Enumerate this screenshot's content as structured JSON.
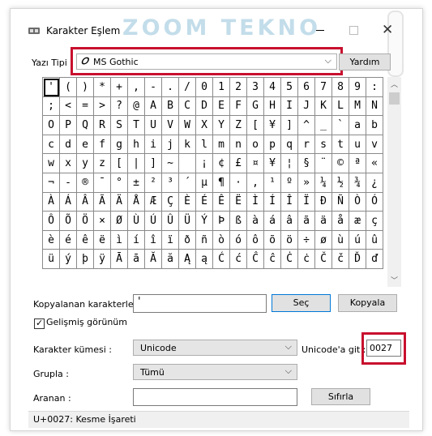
{
  "window": {
    "title": "Karakter Eşlem",
    "watermark": "ZOOM TEKNO"
  },
  "font_row": {
    "label": "Yazı Tipi :",
    "font_icon": "𝑂",
    "value": "MS Gothic",
    "help_button": "Yardım"
  },
  "characters": [
    "'",
    "(",
    ")",
    "*",
    "+",
    ",",
    "-",
    ".",
    "/",
    "0",
    "1",
    "2",
    "3",
    "4",
    "5",
    "6",
    "7",
    "8",
    "9",
    ":",
    ";",
    "<",
    "=",
    ">",
    "?",
    "@",
    "A",
    "B",
    "C",
    "D",
    "E",
    "F",
    "G",
    "H",
    "I",
    "J",
    "K",
    "L",
    "M",
    "N",
    "O",
    "P",
    "Q",
    "R",
    "S",
    "T",
    "U",
    "V",
    "W",
    "X",
    "Y",
    "Z",
    "[",
    "¥",
    "]",
    "^",
    "_",
    "`",
    "a",
    "b",
    "c",
    "d",
    "e",
    "f",
    "g",
    "h",
    "i",
    "j",
    "k",
    "l",
    "m",
    "n",
    "o",
    "p",
    "q",
    "r",
    "s",
    "t",
    "u",
    "v",
    "w",
    "x",
    "y",
    "z",
    "[",
    "|",
    "]",
    "~",
    " ",
    "¡",
    "¢",
    "£",
    "¤",
    "¥",
    "¦",
    "§",
    "¨",
    "©",
    "ª",
    "«",
    "¬",
    "-",
    "®",
    "¯",
    "°",
    "±",
    "²",
    "³",
    "´",
    "µ",
    "¶",
    "·",
    ",",
    "¹",
    "º",
    "»",
    "¼",
    "½",
    "¾",
    "¿",
    "À",
    "Á",
    "Â",
    "Ã",
    "Ä",
    "Å",
    "Æ",
    "Ç",
    "È",
    "É",
    "Ê",
    "Ë",
    "Ì",
    "Í",
    "Î",
    "Ï",
    "Ð",
    "Ñ",
    "Ò",
    "Ó",
    "Ô",
    "Õ",
    "Ö",
    "×",
    "Ø",
    "Ù",
    "Ú",
    "Û",
    "Ü",
    "Ý",
    "Þ",
    "ß",
    "à",
    "á",
    "â",
    "ã",
    "ä",
    "å",
    "æ",
    "ç",
    "è",
    "é",
    "ê",
    "ë",
    "ì",
    "í",
    "î",
    "ï",
    "ð",
    "ñ",
    "ò",
    "ó",
    "ô",
    "õ",
    "ö",
    "÷",
    "ø",
    "ù",
    "ú",
    "û",
    "ü",
    "ý",
    "þ",
    "ÿ",
    "Ā",
    "ā",
    "Ă",
    "ă",
    "Ą",
    "ą",
    "Ć",
    "ć",
    "Ĉ",
    "ĉ",
    "Ċ",
    "ċ",
    "Č",
    "č",
    "Ď",
    "ď"
  ],
  "selected_index": 0,
  "copy_row": {
    "label": "Kopyalanan karakterler :",
    "value": "'",
    "select_button": "Seç",
    "copy_button": "Kopyala"
  },
  "advanced": {
    "label": "Gelişmiş görünüm",
    "checked": true
  },
  "charset": {
    "label": "Karakter kümesi :",
    "value": "Unicode"
  },
  "goto_unicode": {
    "label": "Unicode'a git :",
    "value": "0027"
  },
  "group": {
    "label": "Grupla :",
    "value": "Tümü"
  },
  "search": {
    "label": "Aranan :",
    "value": "",
    "reset_button": "Sıfırla"
  },
  "status": {
    "text": "U+0027: Kesme İşareti"
  },
  "colors": {
    "highlight": "#c8102e",
    "focus": "#0078d7"
  }
}
